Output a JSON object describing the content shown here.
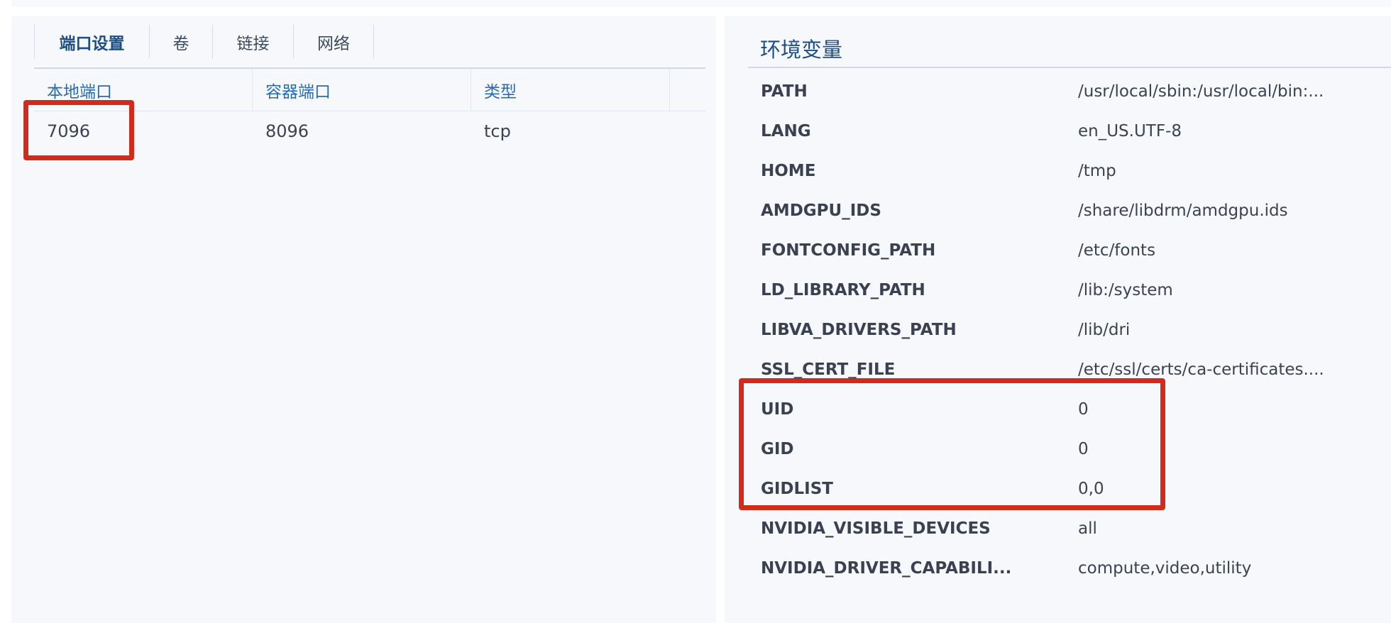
{
  "ports_panel": {
    "tabs": [
      {
        "label": "端口设置",
        "active": true
      },
      {
        "label": "卷",
        "active": false
      },
      {
        "label": "链接",
        "active": false
      },
      {
        "label": "网络",
        "active": false
      }
    ],
    "columns": [
      "本地端口",
      "容器端口",
      "类型"
    ],
    "rows": [
      {
        "local_port": "7096",
        "container_port": "8096",
        "type": "tcp"
      }
    ]
  },
  "env_panel": {
    "title": "环境变量",
    "variables": [
      {
        "key": "PATH",
        "value": "/usr/local/sbin:/usr/local/bin:..."
      },
      {
        "key": "LANG",
        "value": "en_US.UTF-8"
      },
      {
        "key": "HOME",
        "value": "/tmp"
      },
      {
        "key": "AMDGPU_IDS",
        "value": "/share/libdrm/amdgpu.ids"
      },
      {
        "key": "FONTCONFIG_PATH",
        "value": "/etc/fonts"
      },
      {
        "key": "LD_LIBRARY_PATH",
        "value": "/lib:/system"
      },
      {
        "key": "LIBVA_DRIVERS_PATH",
        "value": "/lib/dri"
      },
      {
        "key": "SSL_CERT_FILE",
        "value": "/etc/ssl/certs/ca-certificates...."
      },
      {
        "key": "UID",
        "value": "0"
      },
      {
        "key": "GID",
        "value": "0"
      },
      {
        "key": "GIDLIST",
        "value": "0,0"
      },
      {
        "key": "NVIDIA_VISIBLE_DEVICES",
        "value": "all"
      },
      {
        "key": "NVIDIA_DRIVER_CAPABILI...",
        "value": "compute,video,utility"
      }
    ]
  },
  "colors": {
    "panel_bg": "#f6f8fc",
    "accent": "#1f4e85",
    "header_text": "#2a6bb0",
    "highlight": "#d42a1c"
  }
}
